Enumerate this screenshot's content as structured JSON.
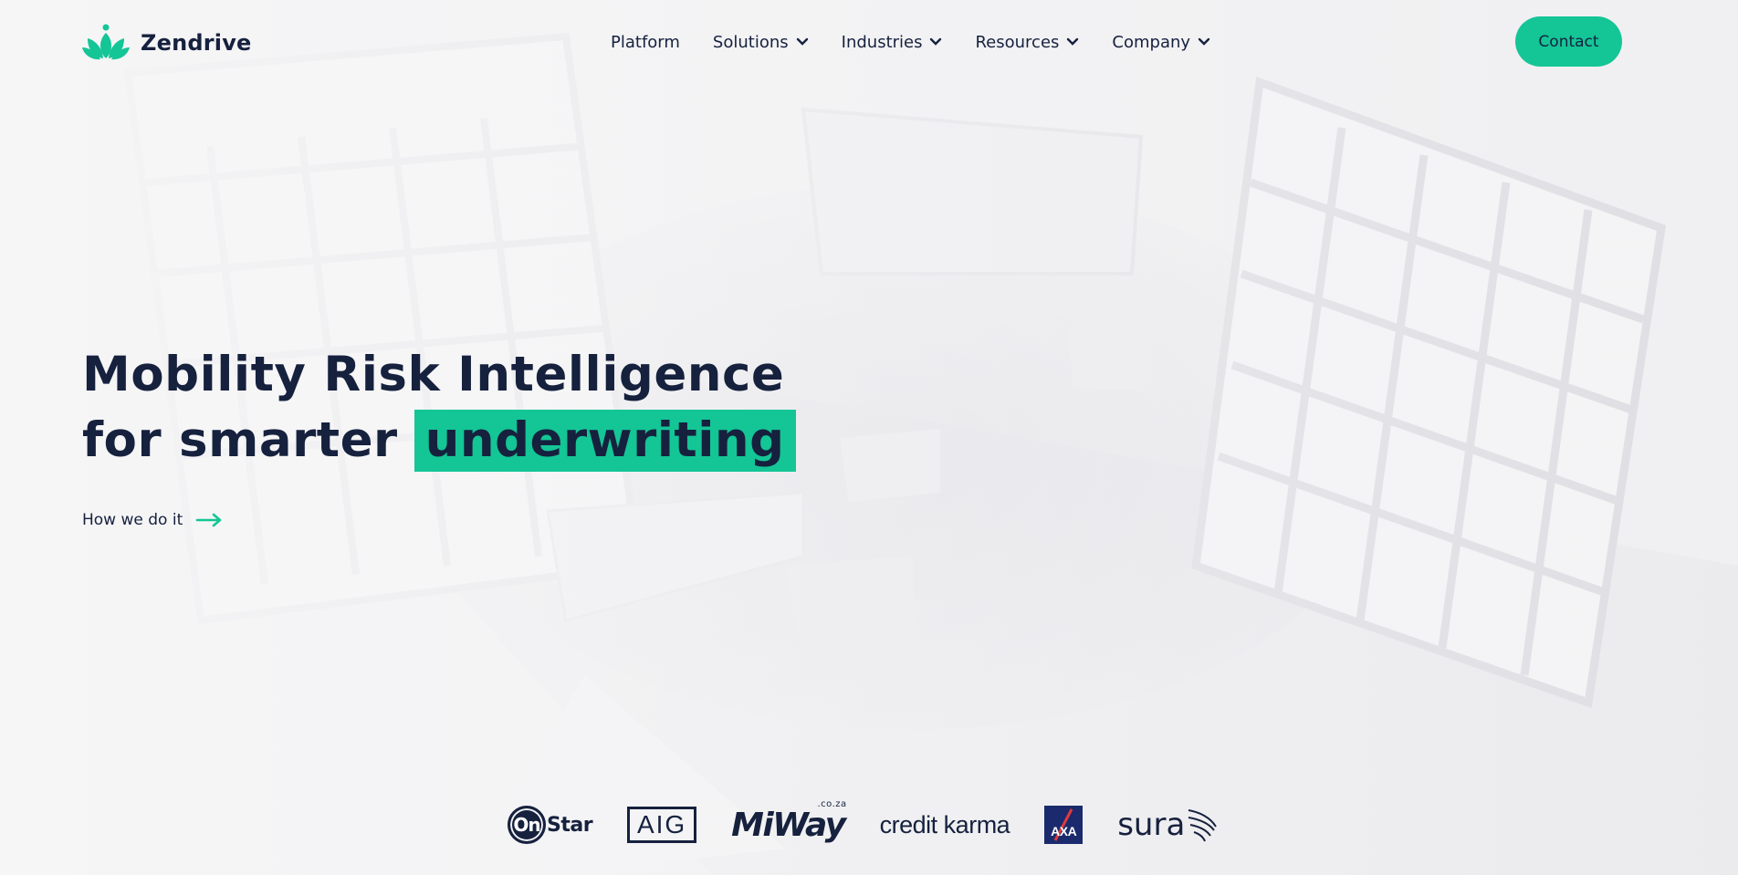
{
  "brand": {
    "name": "Zendrive",
    "accent_color": "#14c596",
    "text_color": "#16213e",
    "logo_icon": "lotus-icon"
  },
  "nav": {
    "items": [
      {
        "label": "Platform",
        "has_dropdown": false
      },
      {
        "label": "Solutions",
        "has_dropdown": true
      },
      {
        "label": "Industries",
        "has_dropdown": true
      },
      {
        "label": "Resources",
        "has_dropdown": true
      },
      {
        "label": "Company",
        "has_dropdown": true
      }
    ],
    "dropdown_icon": "chevron-down-icon",
    "contact_label": "Contact"
  },
  "hero": {
    "line1": "Mobility Risk Intelligence",
    "line2_prefix": "for smarter",
    "line2_highlight": "underwriting",
    "cta_label": "How we do it",
    "cta_icon": "arrow-right-icon"
  },
  "partners": {
    "onstar": {
      "on": "On",
      "rest": "Star"
    },
    "aig": "AIG",
    "miway": {
      "name": "MiWay",
      "suffix": ".co.za"
    },
    "credit_karma": "credit karma",
    "axa": "AXA",
    "sura": "sura"
  }
}
